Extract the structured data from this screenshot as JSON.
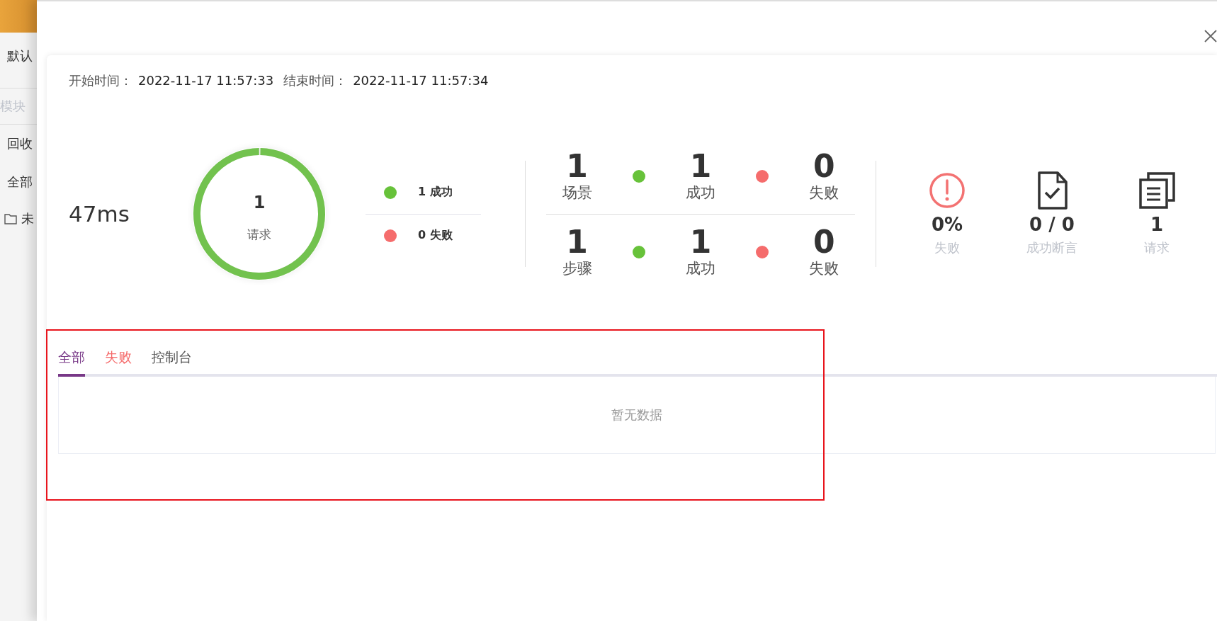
{
  "background_page": {
    "items": [
      {
        "kind": "label",
        "text": "默认"
      },
      {
        "kind": "placeholder",
        "text": "模块"
      },
      {
        "kind": "label",
        "text": "回收"
      },
      {
        "kind": "label",
        "text": "全部"
      },
      {
        "kind": "folder",
        "text": "未"
      }
    ]
  },
  "report": {
    "times": [
      {
        "label": "开始时间：",
        "value": "2022-11-17 11:57:33"
      },
      {
        "label": "结束时间：",
        "value": "2022-11-17 11:57:34"
      }
    ],
    "duration": "47ms",
    "ring": {
      "count": "1",
      "label": "请求",
      "level": 1
    },
    "legend": [
      {
        "text": "1 成功",
        "color": "#67c23a"
      },
      {
        "text": "0 失败",
        "color": "#f56c6c"
      }
    ],
    "grid_rows": [
      {
        "items": [
          {
            "kind": "count",
            "value": "1",
            "label": "场景"
          },
          {
            "kind": "dot",
            "color": "#67c23a"
          },
          {
            "kind": "count",
            "value": "1",
            "label": "成功"
          },
          {
            "kind": "dot",
            "color": "#f56c6c"
          },
          {
            "kind": "count",
            "value": "0",
            "label": "失败"
          }
        ]
      },
      {
        "items": [
          {
            "kind": "count",
            "value": "1",
            "label": "步骤"
          },
          {
            "kind": "dot",
            "color": "#67c23a"
          },
          {
            "kind": "count",
            "value": "1",
            "label": "成功"
          },
          {
            "kind": "dot",
            "color": "#f56c6c"
          },
          {
            "kind": "count",
            "value": "0",
            "label": "失败"
          }
        ]
      }
    ],
    "summary": [
      {
        "kind": "alert",
        "value": "0%",
        "label": "失败"
      },
      {
        "kind": "document",
        "value": "0 / 0",
        "label": "成功断言"
      },
      {
        "kind": "copies",
        "value": "1",
        "label": "请求"
      }
    ],
    "tabs_section": {
      "highlighted": true,
      "tabs": [
        {
          "label": "全部",
          "kind": "all",
          "selected": true
        },
        {
          "label": "失败",
          "kind": "error",
          "selected": false
        },
        {
          "label": "控制台",
          "kind": "plain",
          "selected": false
        }
      ],
      "empty_text": "暂无数据"
    }
  }
}
